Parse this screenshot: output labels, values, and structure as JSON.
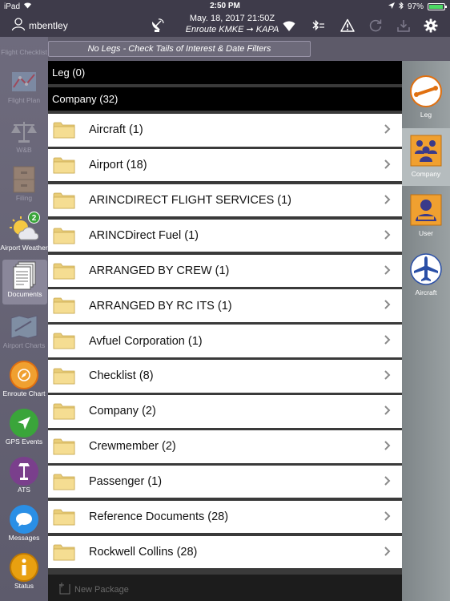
{
  "status_bar": {
    "device": "iPad",
    "time": "2:50 PM",
    "battery": "97%",
    "battery_level": 0.97
  },
  "navbar": {
    "username": "mbentley",
    "datetime": "May. 18, 2017  21:50Z",
    "route": "Enroute KMKE ➞ KAPA"
  },
  "filter": {
    "message": "No Legs - Check Tails of Interest & Date Filters"
  },
  "left_nav": [
    {
      "label": "Flight Checklist",
      "icon": "checklist-icon"
    },
    {
      "label": "Flight Plan",
      "icon": "flight-plan-icon"
    },
    {
      "label": "W&B",
      "icon": "scale-icon"
    },
    {
      "label": "Filing",
      "icon": "filing-cabinet-icon"
    },
    {
      "label": "Airport Weather",
      "icon": "weather-icon",
      "badge": "2"
    },
    {
      "label": "Documents",
      "icon": "documents-icon"
    },
    {
      "label": "Airport Charts",
      "icon": "airport-charts-icon"
    },
    {
      "label": "Enroute Chart",
      "icon": "enroute-chart-icon"
    },
    {
      "label": "GPS Events",
      "icon": "gps-arrow-icon"
    },
    {
      "label": "ATS",
      "icon": "ats-icon"
    },
    {
      "label": "Messages",
      "icon": "messages-icon"
    },
    {
      "label": "Status",
      "icon": "status-info-icon"
    }
  ],
  "main": {
    "leg_header": "Leg  (0)",
    "company_header": "Company (32)",
    "folders": [
      "Aircraft (1)",
      "Airport (18)",
      "ARINCDIRECT FLIGHT SERVICES (1)",
      "ARINCDirect Fuel (1)",
      "ARRANGED BY CREW (1)",
      "ARRANGED BY RC ITS (1)",
      "Avfuel Corporation (1)",
      "Checklist (8)",
      "Company (2)",
      "Crewmember (2)",
      "Passenger (1)",
      "Reference Documents (28)",
      "Rockwell Collins (28)"
    ]
  },
  "bottom": {
    "new_package": "New Package"
  },
  "right_nav": [
    {
      "label": "Leg",
      "icon": "leg-icon"
    },
    {
      "label": "Company",
      "icon": "company-icon"
    },
    {
      "label": "User",
      "icon": "user-icon"
    },
    {
      "label": "Aircraft",
      "icon": "aircraft-icon"
    }
  ],
  "colors": {
    "chrome": "#3e3b4a",
    "folder": "#f5dd92",
    "folder_tab": "#e9cd78",
    "orange": "#f0a030",
    "blue": "#2a6fd6",
    "green": "#3aa53a"
  }
}
